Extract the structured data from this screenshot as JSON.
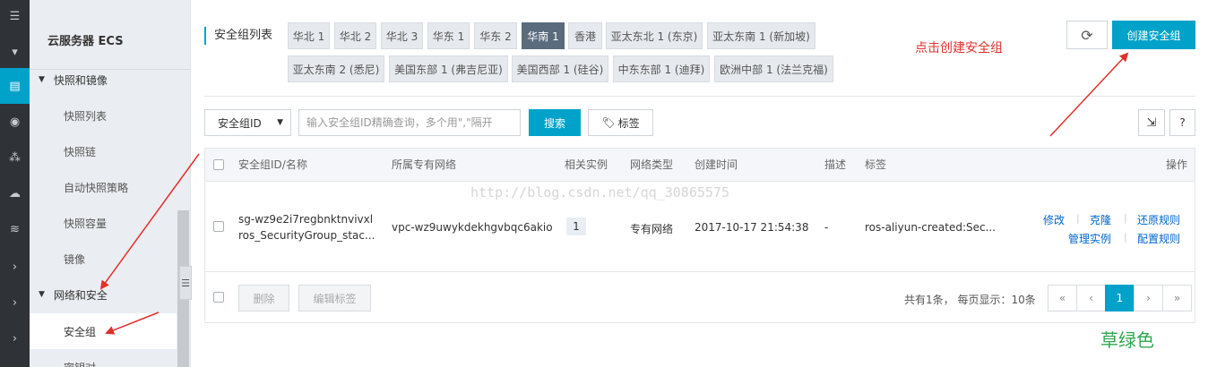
{
  "sidebar": {
    "title": "云服务器 ECS",
    "groups": [
      {
        "label": "快照和镜像",
        "items": [
          "快照列表",
          "快照链",
          "自动快照策略",
          "快照容量",
          "镜像"
        ]
      },
      {
        "label": "网络和安全",
        "items": [
          "安全组",
          "密钥对"
        ]
      }
    ],
    "active_item": "安全组"
  },
  "header": {
    "list_title": "安全组列表",
    "regions_row1": [
      "华北 1",
      "华北 2",
      "华北 3",
      "华东 1",
      "华东 2",
      "华南 1",
      "香港",
      "亚太东北 1 (东京)",
      "亚太东南 1 (新加坡)"
    ],
    "regions_row2": [
      "亚太东南 2 (悉尼)",
      "美国东部 1 (弗吉尼亚)",
      "美国西部 1 (硅谷)",
      "中东东部 1 (迪拜)",
      "欧洲中部 1 (法兰克福)"
    ],
    "active_region": "华南 1",
    "create_label": "创建安全组"
  },
  "annotations": {
    "red": "点击创建安全组",
    "green": "草绿色"
  },
  "watermark": "http://blog.csdn.net/qq_30865575",
  "search": {
    "select_value": "安全组ID",
    "placeholder": "输入安全组ID精确查询，多个用\",\"隔开",
    "search_label": "搜索",
    "tag_label": "标签"
  },
  "table": {
    "columns": [
      "安全组ID/名称",
      "所属专有网络",
      "相关实例",
      "网络类型",
      "创建时间",
      "描述",
      "标签",
      "操作"
    ],
    "rows": [
      {
        "id": "sg-wz9e2i7regbnktnvivxl",
        "name": "ros_SecurityGroup_stac...",
        "vpc": "vpc-wz9uwykdekhgvbqc6akio",
        "instances": "1",
        "network_type": "专有网络",
        "created": "2017-10-17 21:54:38",
        "description": "-",
        "tags": "ros-aliyun-created:Sec...",
        "actions": [
          "修改",
          "克隆",
          "还原规则",
          "管理实例",
          "配置规则"
        ]
      }
    ]
  },
  "footer": {
    "delete_label": "删除",
    "edit_tags_label": "编辑标签",
    "summary": "共有1条， 每页显示：10条",
    "pagination": [
      "«",
      "‹",
      "1",
      "›",
      "»"
    ],
    "current_page": "1"
  },
  "colors": {
    "accent": "#00a2ca",
    "annotation_red": "#e0312c",
    "annotation_green": "#2fa84f"
  }
}
